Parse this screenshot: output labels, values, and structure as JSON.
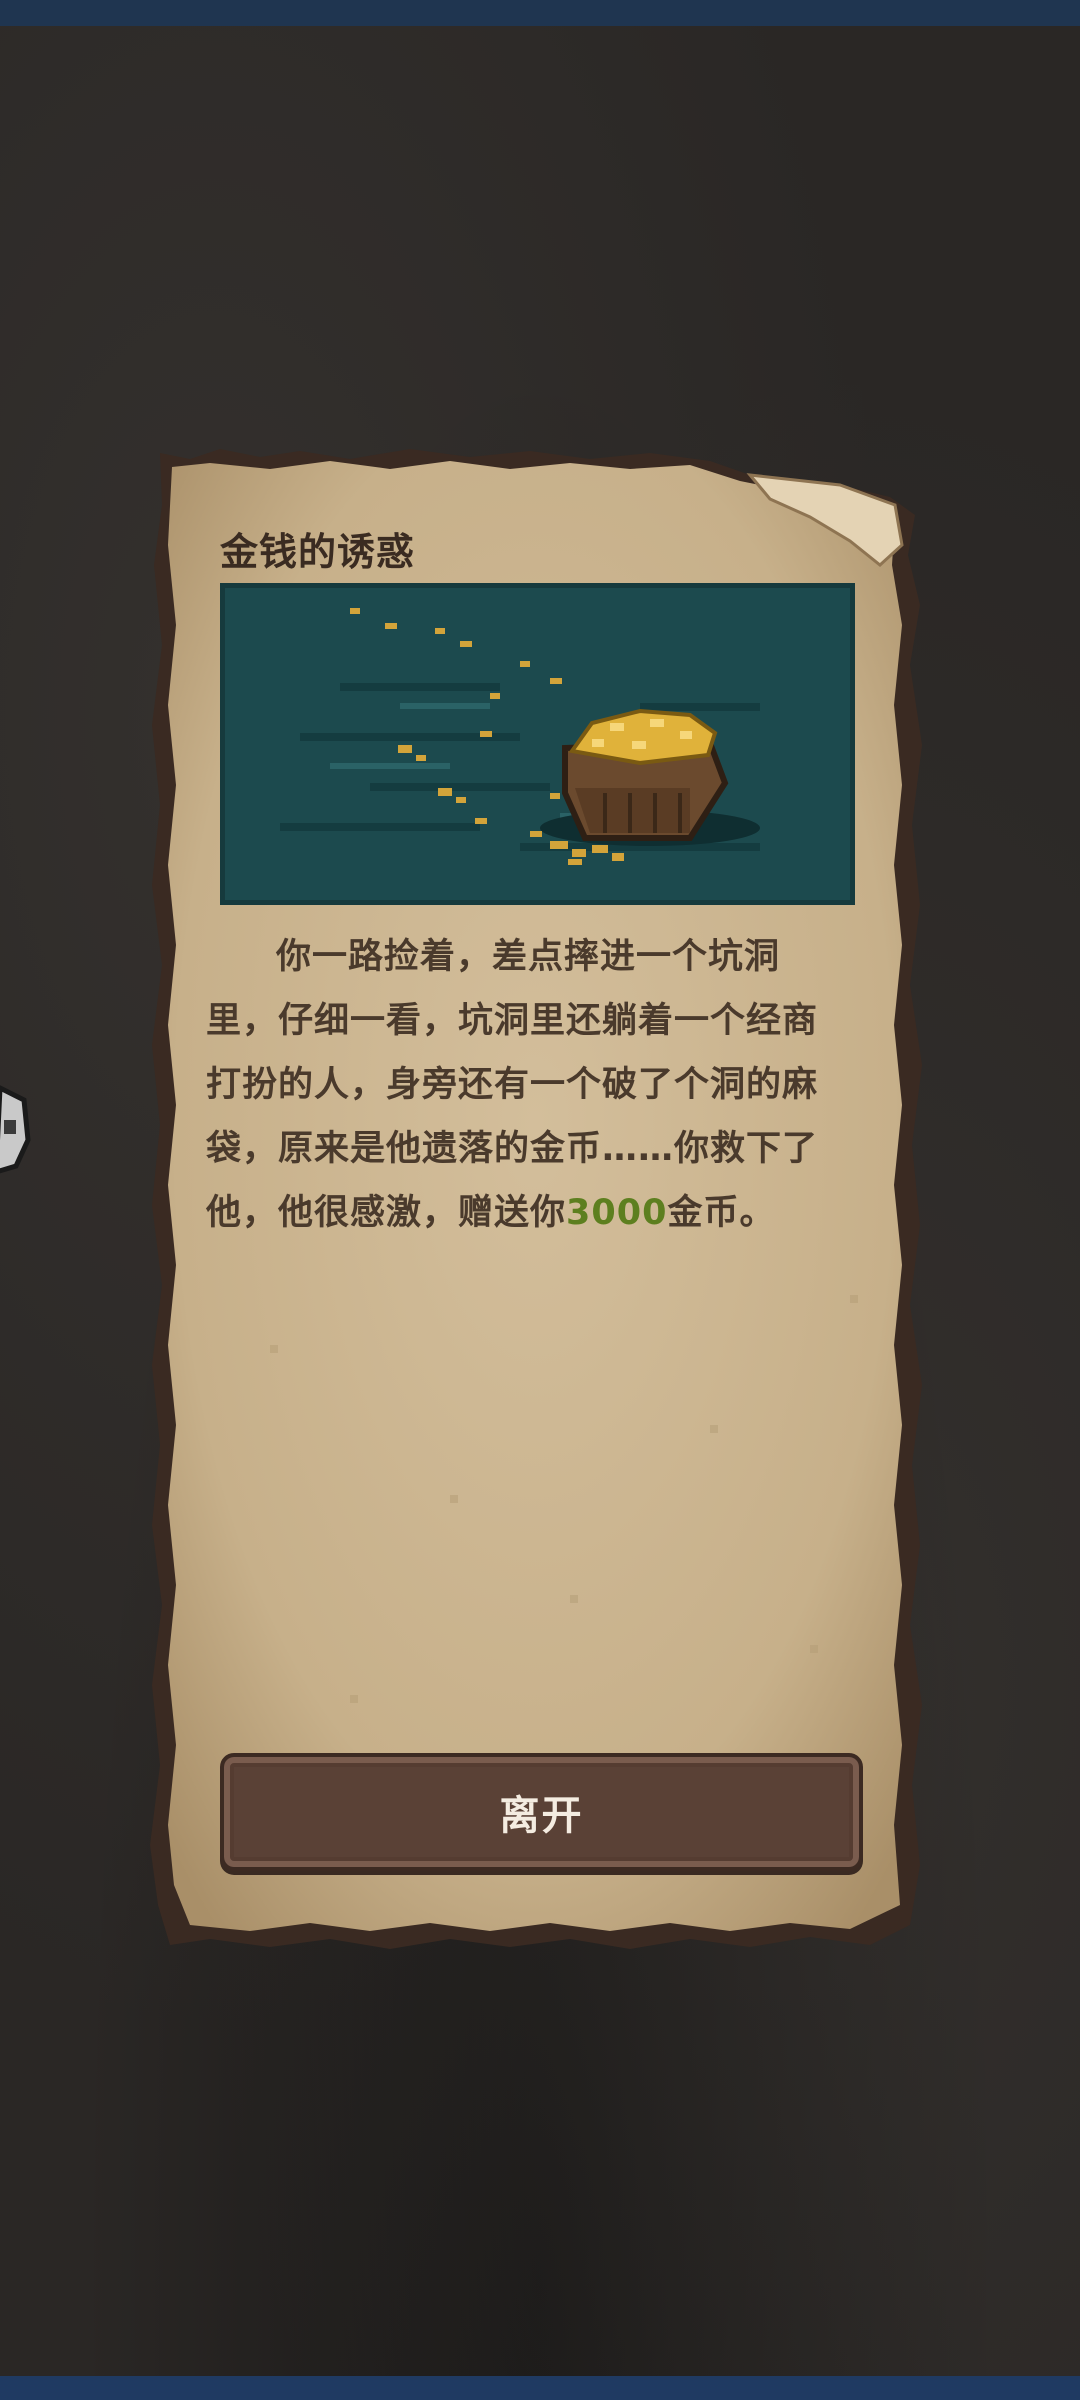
{
  "event": {
    "title": "金钱的诱惑",
    "story_before": "你一路捡着，差点摔进一个坑洞里，仔细一看，坑洞里还躺着一个经商打扮的人，身旁还有一个破了个洞的麻袋，原来是他遗落的金币……你救下了他，他很感激，赠送你",
    "reward_amount": "3000",
    "story_after": "金币。",
    "scene_image": "gold-treasure-chest-in-water"
  },
  "actions": {
    "leave_label": "离开"
  },
  "colors": {
    "reward": "#5d7f1f",
    "parchment": "#cfb995",
    "button": "#5a4136",
    "water": "#1c4a4e"
  }
}
